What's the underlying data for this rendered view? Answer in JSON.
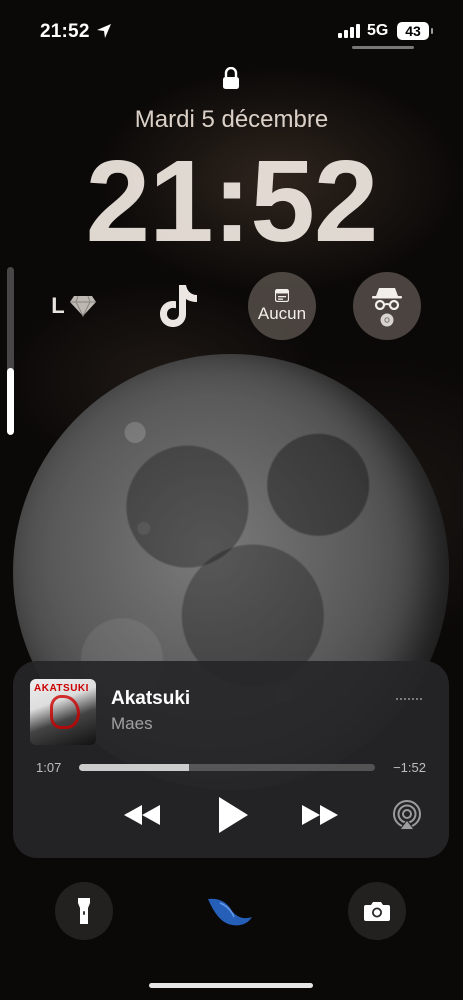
{
  "status_bar": {
    "time": "21:52",
    "network": "5G",
    "battery": "43",
    "location_icon": "location-arrow-icon",
    "signal_icon": "cellular-signal-icon"
  },
  "lock_screen": {
    "lock_icon": "lock-icon",
    "date": "Mardi 5 décembre",
    "time": "21:52"
  },
  "volume": {
    "level_fraction": 0.4
  },
  "widgets": {
    "l_widget": {
      "label": "L",
      "icon": "diamond-icon"
    },
    "tiktok": {
      "icon": "tiktok-icon"
    },
    "agenda": {
      "label": "Aucun",
      "icon": "calendar-icon"
    },
    "privacy": {
      "icon": "incognito-icon",
      "sub_icon": "chrome-icon"
    }
  },
  "now_playing": {
    "album_art_text": "AKATSUKI",
    "title": "Akatsuki",
    "artist": "Maes",
    "elapsed": "1:07",
    "remaining": "−1:52",
    "progress_fraction": 0.37,
    "controls": {
      "rewind": "rewind-icon",
      "play": "play-icon",
      "forward": "fast-forward-icon",
      "airplay": "airplay-icon"
    }
  },
  "bottom": {
    "flashlight": "flashlight-icon",
    "camera": "camera-icon"
  },
  "colors": {
    "player_background": "#262628",
    "widget_background": "#968c82",
    "accent_blue": "#2b6fd6"
  }
}
